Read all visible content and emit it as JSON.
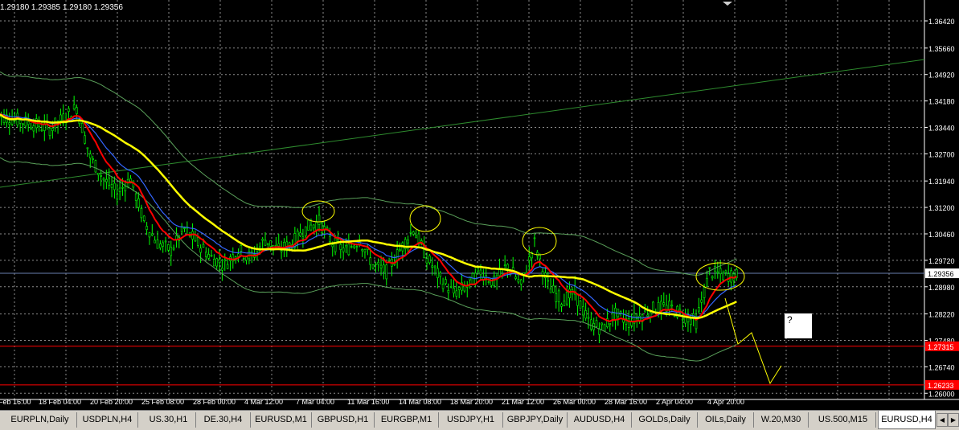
{
  "ohlc_text": "1.29180 1.29385 1.29180 1.29356",
  "price_axis": {
    "labels": [
      "1.36420",
      "1.35660",
      "1.34920",
      "1.34180",
      "1.33440",
      "1.32700",
      "1.31940",
      "1.31200",
      "1.30460",
      "1.29720",
      "1.28980",
      "1.28220",
      "1.27480",
      "1.26740",
      "1.26000"
    ],
    "current": "1.29356",
    "level1": "1.27315",
    "level2": "1.26233"
  },
  "time_axis": [
    "Feb 16:00",
    "18 Feb 04:00",
    "20 Feb 20:00",
    "25 Feb 08:00",
    "28 Feb 00:00",
    "4 Mar 12:00",
    "7 Mar 04:00",
    "11 Mar 16:00",
    "14 Mar 08:00",
    "18 Mar 20:00",
    "21 Mar 12:00",
    "26 Mar 00:00",
    "28 Mar 16:00",
    "2 Apr 04:00",
    "4 Apr 20:00"
  ],
  "annotation_text": "?",
  "tabs": [
    "EURPLN,Daily",
    "USDPLN,H4",
    "US.30,H1",
    "DE.30,H4",
    "EURUSD,M1",
    "GBPUSD,H1",
    "EURGBP,M1",
    "USDJPY,H1",
    "GBPJPY,Daily",
    "AUDUSD,H4",
    "GOLDs,Daily",
    "OILs,Daily",
    "W.20,M30",
    "US.500,M15",
    "EURUSD,H4"
  ],
  "active_tab": "EURUSD,H4",
  "colors": {
    "background": "#000000",
    "grid": "#8c8c8c",
    "candles": "#00ff00",
    "sma": "#ffff00",
    "ema_fast": "#ff0000",
    "ema_slow": "#3366ff",
    "bands": "#5aa05a",
    "trendline": "#2e8b2e",
    "level": "#ff0000",
    "bid_line": "#6a7fb0"
  }
}
